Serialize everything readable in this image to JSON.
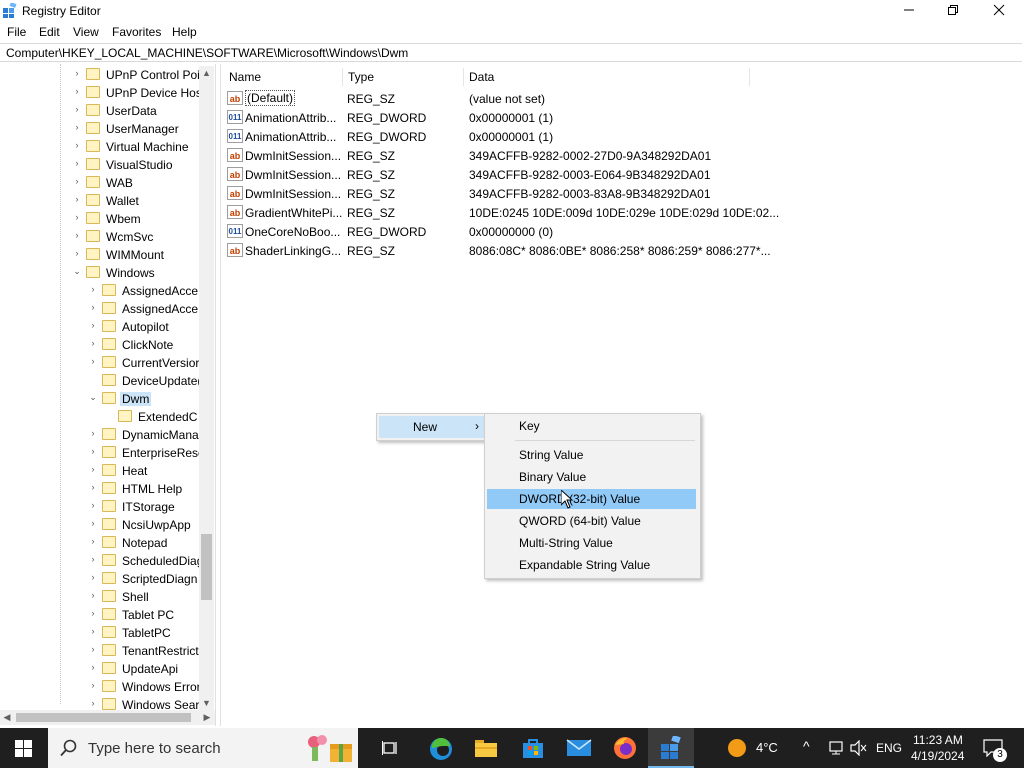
{
  "window": {
    "title": "Registry Editor"
  },
  "menu": [
    "File",
    "Edit",
    "View",
    "Favorites",
    "Help"
  ],
  "address": "Computer\\HKEY_LOCAL_MACHINE\\SOFTWARE\\Microsoft\\Windows\\Dwm",
  "tree": [
    {
      "label": "UPnP Control Poi",
      "level": 0,
      "expander": "›"
    },
    {
      "label": "UPnP Device Hos",
      "level": 0,
      "expander": "›"
    },
    {
      "label": "UserData",
      "level": 0,
      "expander": "›"
    },
    {
      "label": "UserManager",
      "level": 0,
      "expander": "›"
    },
    {
      "label": "Virtual Machine",
      "level": 0,
      "expander": "›"
    },
    {
      "label": "VisualStudio",
      "level": 0,
      "expander": "›"
    },
    {
      "label": "WAB",
      "level": 0,
      "expander": "›"
    },
    {
      "label": "Wallet",
      "level": 0,
      "expander": "›"
    },
    {
      "label": "Wbem",
      "level": 0,
      "expander": "›"
    },
    {
      "label": "WcmSvc",
      "level": 0,
      "expander": "›"
    },
    {
      "label": "WIMMount",
      "level": 0,
      "expander": "›"
    },
    {
      "label": "Windows",
      "level": 0,
      "expander": "⌄"
    },
    {
      "label": "AssignedAcce",
      "level": 1,
      "expander": "›"
    },
    {
      "label": "AssignedAcce",
      "level": 1,
      "expander": "›"
    },
    {
      "label": "Autopilot",
      "level": 1,
      "expander": "›"
    },
    {
      "label": "ClickNote",
      "level": 1,
      "expander": "›"
    },
    {
      "label": "CurrentVersior",
      "level": 1,
      "expander": "›"
    },
    {
      "label": "DeviceUpdate(",
      "level": 1,
      "expander": ""
    },
    {
      "label": "Dwm",
      "level": 1,
      "expander": "⌄",
      "selected": true
    },
    {
      "label": "ExtendedC",
      "level": 2,
      "expander": ""
    },
    {
      "label": "DynamicMana",
      "level": 1,
      "expander": "›"
    },
    {
      "label": "EnterpriseResc",
      "level": 1,
      "expander": "›"
    },
    {
      "label": "Heat",
      "level": 1,
      "expander": "›"
    },
    {
      "label": "HTML Help",
      "level": 1,
      "expander": "›"
    },
    {
      "label": "ITStorage",
      "level": 1,
      "expander": "›"
    },
    {
      "label": "NcsiUwpApp",
      "level": 1,
      "expander": "›"
    },
    {
      "label": "Notepad",
      "level": 1,
      "expander": "›"
    },
    {
      "label": "ScheduledDiag",
      "level": 1,
      "expander": "›"
    },
    {
      "label": "ScriptedDiagn",
      "level": 1,
      "expander": "›"
    },
    {
      "label": "Shell",
      "level": 1,
      "expander": "›"
    },
    {
      "label": "Tablet PC",
      "level": 1,
      "expander": "›"
    },
    {
      "label": "TabletPC",
      "level": 1,
      "expander": "›"
    },
    {
      "label": "TenantRestrict",
      "level": 1,
      "expander": "›"
    },
    {
      "label": "UpdateApi",
      "level": 1,
      "expander": "›"
    },
    {
      "label": "Windows Error",
      "level": 1,
      "expander": "›"
    },
    {
      "label": "Windows Sear",
      "level": 1,
      "expander": "›"
    }
  ],
  "list": {
    "headers": {
      "name": "Name",
      "type": "Type",
      "data": "Data"
    },
    "rows": [
      {
        "icon": "ab",
        "name": "(Default)",
        "type": "REG_SZ",
        "data": "(value not set)"
      },
      {
        "icon": "dword",
        "name": "AnimationAttrib...",
        "type": "REG_DWORD",
        "data": "0x00000001 (1)"
      },
      {
        "icon": "dword",
        "name": "AnimationAttrib...",
        "type": "REG_DWORD",
        "data": "0x00000001 (1)"
      },
      {
        "icon": "ab",
        "name": "DwmInitSession...",
        "type": "REG_SZ",
        "data": "349ACFFB-9282-0002-27D0-9A348292DA01"
      },
      {
        "icon": "ab",
        "name": "DwmInitSession...",
        "type": "REG_SZ",
        "data": "349ACFFB-9282-0003-E064-9B348292DA01"
      },
      {
        "icon": "ab",
        "name": "DwmInitSession...",
        "type": "REG_SZ",
        "data": "349ACFFB-9282-0003-83A8-9B348292DA01"
      },
      {
        "icon": "ab",
        "name": "GradientWhitePi...",
        "type": "REG_SZ",
        "data": "10DE:0245 10DE:009d 10DE:029e 10DE:029d 10DE:02..."
      },
      {
        "icon": "dword",
        "name": "OneCoreNoBoo...",
        "type": "REG_DWORD",
        "data": "0x00000000 (0)"
      },
      {
        "icon": "ab",
        "name": "ShaderLinkingG...",
        "type": "REG_SZ",
        "data": "8086:08C* 8086:0BE* 8086:258* 8086:259* 8086:277*..."
      }
    ]
  },
  "context_menu": {
    "new_label": "New"
  },
  "submenu": {
    "items": [
      "Key",
      "String Value",
      "Binary Value",
      "DWORD (32-bit) Value",
      "QWORD (64-bit) Value",
      "Multi-String Value",
      "Expandable String Value"
    ],
    "highlighted": "DWORD (32-bit) Value"
  },
  "taskbar": {
    "search_placeholder": "Type here to search",
    "weather": "4°C",
    "language": "ENG",
    "time": "11:23 AM",
    "date": "4/19/2024",
    "notification_count": "3"
  },
  "colors": {
    "selection": "#cce4f7",
    "menu_highlight": "#91c9f7",
    "taskbar": "#1f1f1f"
  }
}
